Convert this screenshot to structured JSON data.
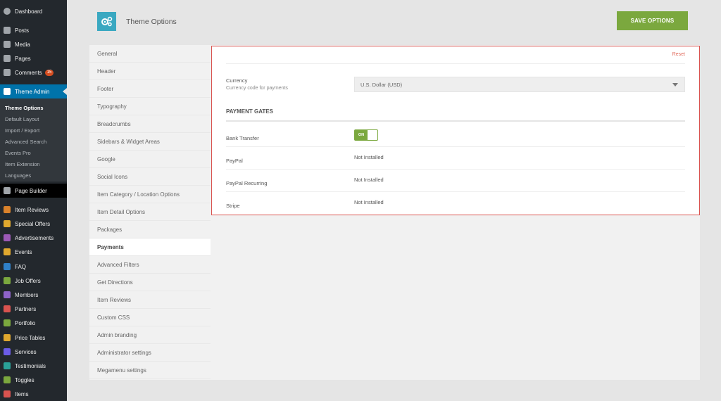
{
  "sidebar": {
    "items": [
      {
        "label": "Dashboard",
        "icon": "dashboard-icon",
        "color": "#a0a5aa"
      },
      {
        "label": "Posts",
        "icon": "pin-icon",
        "color": "#a0a5aa"
      },
      {
        "label": "Media",
        "icon": "media-icon",
        "color": "#a0a5aa"
      },
      {
        "label": "Pages",
        "icon": "pages-icon",
        "color": "#a0a5aa"
      },
      {
        "label": "Comments",
        "icon": "comments-icon",
        "color": "#a0a5aa",
        "badge": "15"
      },
      {
        "label": "Theme Admin",
        "icon": "theme-admin-icon",
        "color": "#ffffff"
      },
      {
        "label": "Page Builder",
        "icon": "page-builder-icon",
        "color": "#a0a5aa"
      },
      {
        "label": "Item Reviews",
        "icon": "star-icon",
        "color": "#d9822b"
      },
      {
        "label": "Special Offers",
        "icon": "tag-icon",
        "color": "#e0a82e"
      },
      {
        "label": "Advertisements",
        "icon": "ad-icon",
        "color": "#9b59b6"
      },
      {
        "label": "Events",
        "icon": "calendar-icon",
        "color": "#e0a82e"
      },
      {
        "label": "FAQ",
        "icon": "faq-icon",
        "color": "#2f80c8"
      },
      {
        "label": "Job Offers",
        "icon": "job-icon",
        "color": "#7ba83e"
      },
      {
        "label": "Members",
        "icon": "members-icon",
        "color": "#8e63c9"
      },
      {
        "label": "Partners",
        "icon": "partners-icon",
        "color": "#d9534f"
      },
      {
        "label": "Portfolio",
        "icon": "portfolio-icon",
        "color": "#7ba83e"
      },
      {
        "label": "Price Tables",
        "icon": "price-icon",
        "color": "#e0a82e"
      },
      {
        "label": "Services",
        "icon": "services-icon",
        "color": "#6c5ce7"
      },
      {
        "label": "Testimonials",
        "icon": "testimonials-icon",
        "color": "#2aa198"
      },
      {
        "label": "Toggles",
        "icon": "toggles-icon",
        "color": "#7ba83e"
      },
      {
        "label": "Items",
        "icon": "items-icon",
        "color": "#d9534f"
      }
    ],
    "submenu": [
      "Theme Options",
      "Default Layout",
      "Import / Export",
      "Advanced Search",
      "Events Pro",
      "Item Extension",
      "Languages"
    ]
  },
  "header": {
    "title": "Theme Options",
    "save_label": "SAVE OPTIONS"
  },
  "options_nav": [
    "General",
    "Header",
    "Footer",
    "Typography",
    "Breadcrumbs",
    "Sidebars & Widget Areas",
    "Google",
    "Social Icons",
    "Item Category / Location Options",
    "Item Detail Options",
    "Packages",
    "Payments",
    "Advanced Filters",
    "Get Directions",
    "Item Reviews",
    "Custom CSS",
    "Admin branding",
    "Administrator settings",
    "Megamenu settings"
  ],
  "content": {
    "reset_label": "Reset",
    "currency": {
      "label": "Currency",
      "description": "Currency code for payments",
      "value": "U.S. Dollar (USD)"
    },
    "section_title": "PAYMENT GATES",
    "gates": [
      {
        "label": "Bank Transfer",
        "value": "ON"
      },
      {
        "label": "PayPal",
        "value": "Not Installed"
      },
      {
        "label": "PayPal Recurring",
        "value": "Not Installed"
      },
      {
        "label": "Stripe",
        "value": "Not Installed"
      }
    ]
  },
  "colors": {
    "accent": "#7ba83e",
    "wp_blue": "#0073aa",
    "sidebar_bg": "#23282d",
    "border_alert": "#d9534f"
  }
}
